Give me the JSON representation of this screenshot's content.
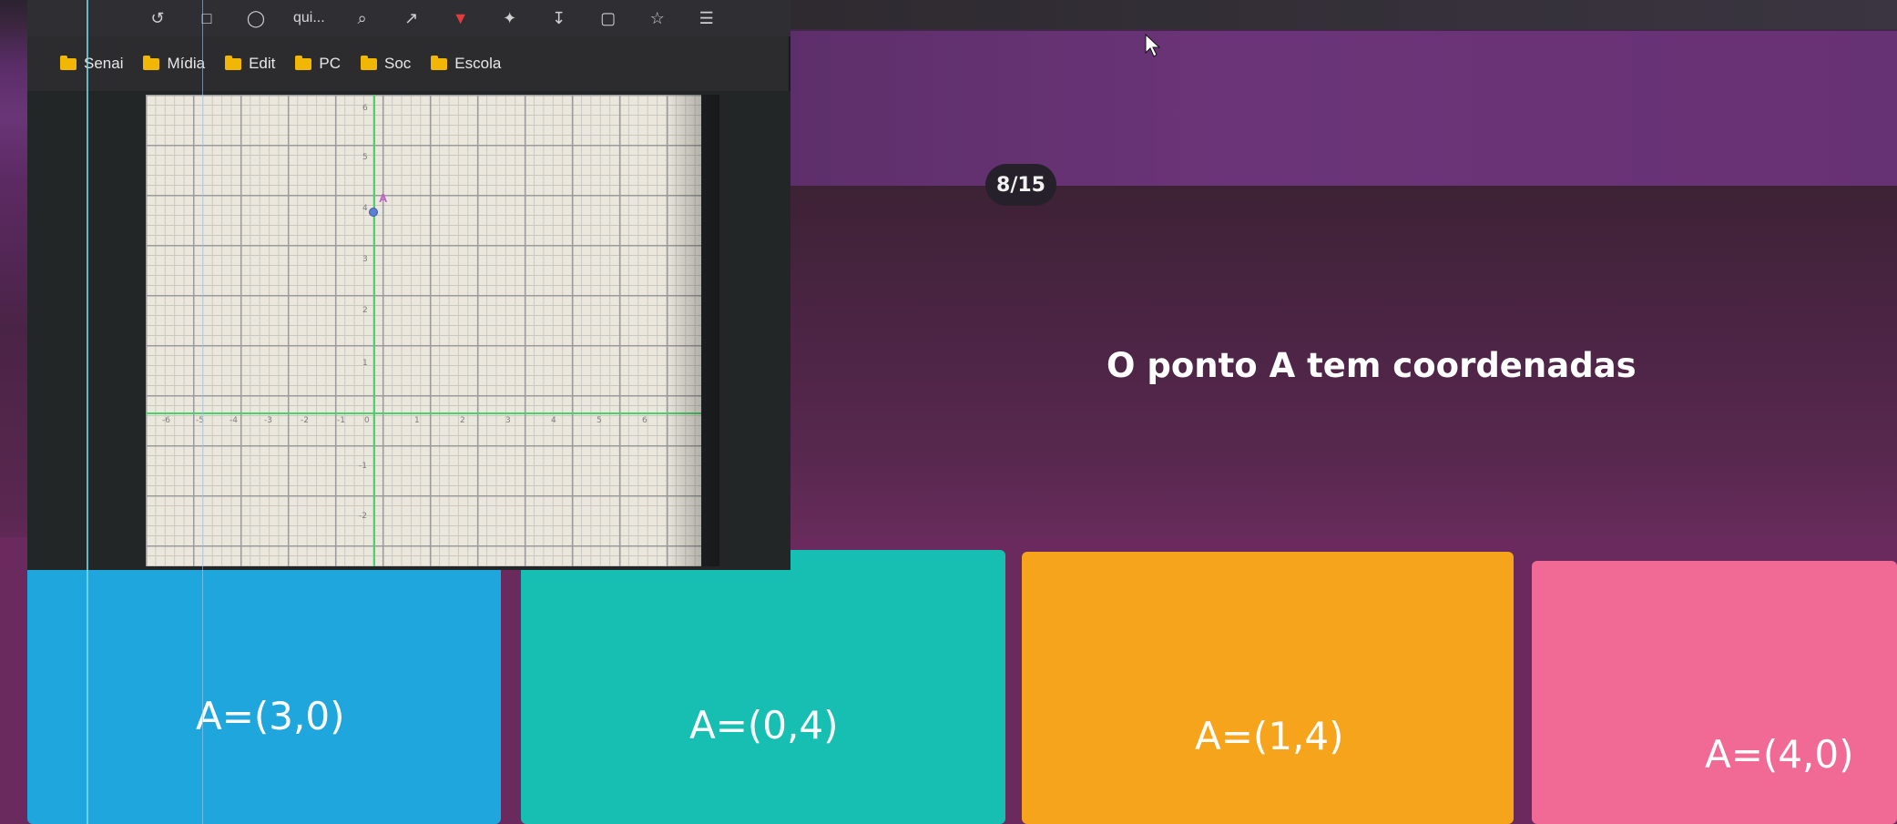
{
  "browser": {
    "toolbar": {
      "url_fragment": "qui...",
      "icons": [
        "back-arrow-icon",
        "page-icon",
        "reader-icon",
        "translate-icon",
        "search-zoom-icon",
        "share-icon",
        "brave-shield-icon",
        "extensions-icon",
        "download-icon",
        "sidebar-icon",
        "favorites-icon",
        "menu-icon"
      ]
    },
    "bookmarks": [
      {
        "label": "Senai"
      },
      {
        "label": "Mídia"
      },
      {
        "label": "Edit"
      },
      {
        "label": "PC"
      },
      {
        "label": "Soc"
      },
      {
        "label": "Escola"
      }
    ],
    "graph": {
      "x_tick_labels": [
        "-6",
        "-5",
        "-4",
        "-3",
        "-2",
        "-1",
        "0",
        "1",
        "2",
        "3",
        "4",
        "5",
        "6"
      ],
      "y_tick_labels": [
        "6",
        "5",
        "4",
        "3",
        "2",
        "1",
        "-1",
        "-2"
      ],
      "point_label": "A",
      "colors": {
        "axis": "#49d16b",
        "point": "#5c7fd1",
        "paper": "#ebe7dd"
      }
    }
  },
  "quiz": {
    "counter": "8/15",
    "question": "O ponto A tem coordenadas",
    "answers": [
      {
        "label": "A=(3,0)",
        "color": "#1fa6dd"
      },
      {
        "label": "A=(0,4)",
        "color": "#17bfb3"
      },
      {
        "label": "A=(1,4)",
        "color": "#f6a41b"
      },
      {
        "label": "A=(4,0)",
        "color": "#f06a95"
      }
    ]
  }
}
